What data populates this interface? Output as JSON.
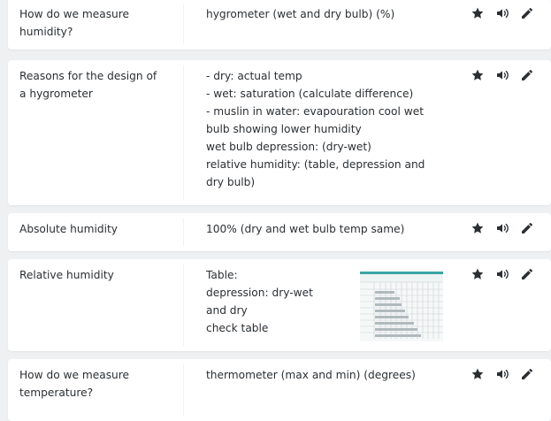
{
  "cards": [
    {
      "term": "How do we measure humidity?",
      "definition": [
        "hygrometer (wet and dry bulb) (%)"
      ]
    },
    {
      "term": "Reasons for the design of a hygrometer",
      "definition": [
        "- dry: actual temp",
        "- wet: saturation (calculate difference)",
        "- muslin in water: evapouration cool wet bulb showing lower humidity",
        "wet bulb depression: (dry-wet)",
        "relative humidity: (table, depression and dry bulb)"
      ]
    },
    {
      "term": "Absolute humidity",
      "definition": [
        "100% (dry and wet bulb temp same)"
      ]
    },
    {
      "term": "Relative humidity",
      "definition": [
        "Table:",
        "depression: dry-wet",
        "and dry",
        "check table"
      ],
      "image": {
        "title": "Difference between wet bulb and dry bulb temperatures",
        "row_header": "Dry bulb temperature (°C)"
      }
    },
    {
      "term": "How do we measure temperature?",
      "definition": [
        "thermometer (max and min) (degrees)"
      ]
    }
  ],
  "icons": {
    "star": "star-icon",
    "audio": "speaker-icon",
    "edit": "pencil-icon"
  },
  "colors": {
    "icon": "#2b2f33",
    "card": "#ffffff",
    "background": "#eef0f2",
    "table_accent": "#3aa6a6"
  }
}
